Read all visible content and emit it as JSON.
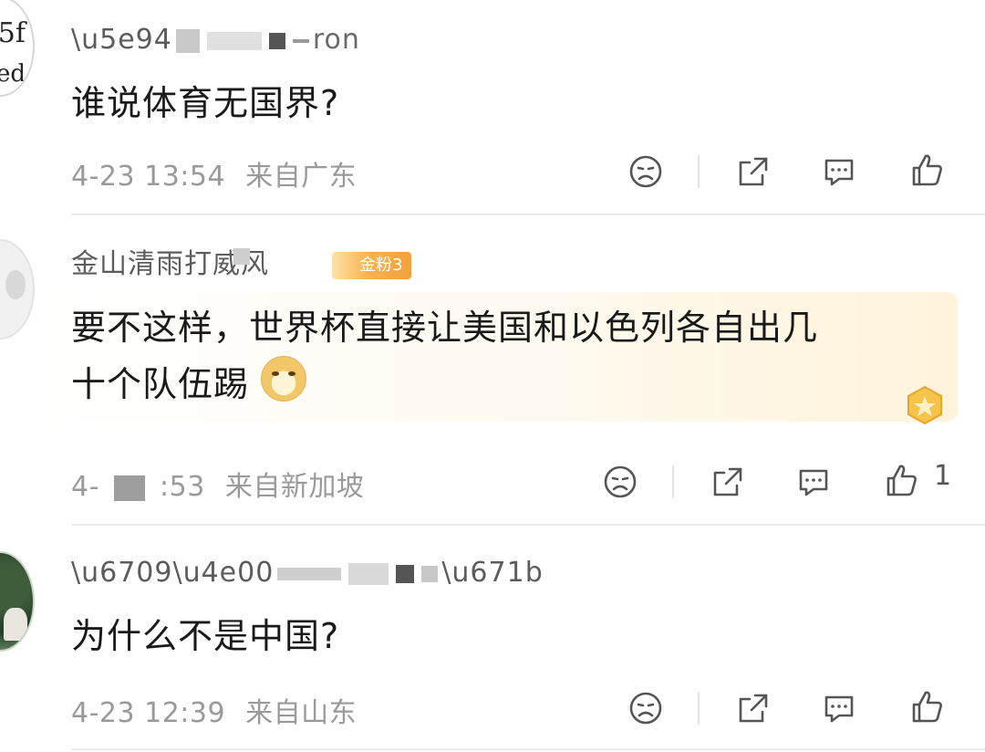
{
  "comments": [
    {
      "username_visible": "应 … ron",
      "text": "谁说体育无国界?",
      "time": "4-23 13:54",
      "location": "来自广东",
      "like_count": "",
      "avatar_text": "江\n园"
    },
    {
      "username_visible": "金山清雨打威风",
      "badge": "金粉3",
      "text_line1": "要不这样，世界杯直接让美国和以色列各自出几",
      "text_line2": "十个队伍踢",
      "time": "4- █ :53",
      "location": "来自新加坡",
      "like_count": "1"
    },
    {
      "username_visible": "有一…望",
      "text": "为什么不是中国?",
      "time": "4-23 12:39",
      "location": "来自山东",
      "like_count": ""
    }
  ],
  "icons": [
    "dislike-face-icon",
    "share-icon",
    "reply-icon",
    "like-icon"
  ],
  "colors": {
    "meta": "#9a9a9a",
    "text": "#1a1a1a",
    "badge": "#f1a23c"
  }
}
